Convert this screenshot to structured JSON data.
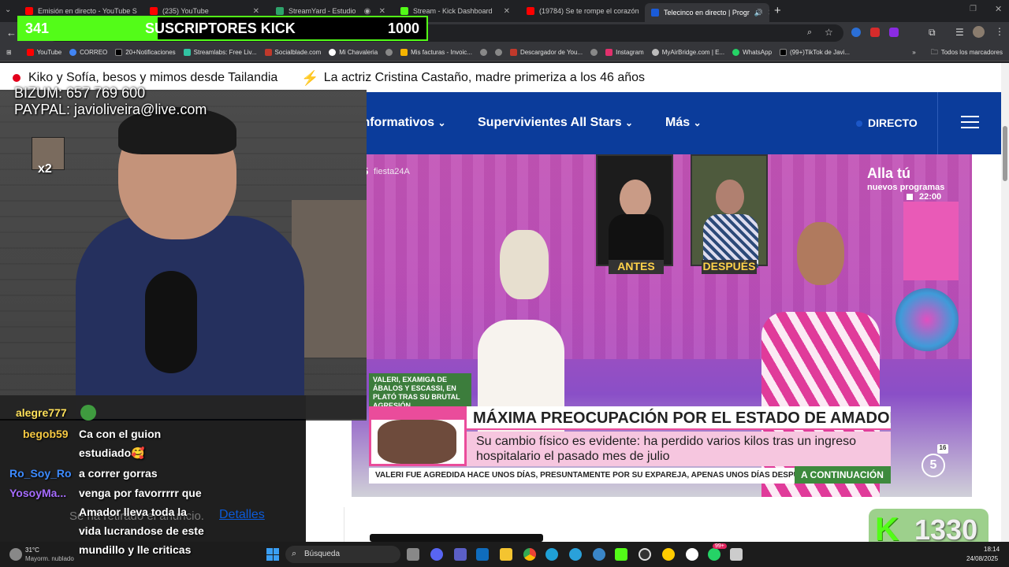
{
  "tabs": [
    {
      "label": "Emisión en directo - YouTube S",
      "fav": "#ff0000"
    },
    {
      "label": "(235) YouTube",
      "fav": "#ff0000"
    },
    {
      "label": "StreamYard - Estudio",
      "fav": "#2ea36b"
    },
    {
      "label": "Stream - Kick Dashboard",
      "fav": "#53fc18"
    },
    {
      "label": "(19784) Se te rompe el corazón",
      "fav": "#ff0000"
    },
    {
      "label": "Telecinco en directo | Progr",
      "fav": "#1a5bd8"
    }
  ],
  "new_tab": "+",
  "bookmarks": [
    {
      "label": "YouTube",
      "color": "#ff0000"
    },
    {
      "label": "CORREO",
      "color": "#4285f4"
    },
    {
      "label": "20+Notificaciones",
      "color": "#000000"
    },
    {
      "label": "Streamlabs: Free Liv...",
      "color": "#31c3a2"
    },
    {
      "label": "Socialblade.com",
      "color": "#c0392b"
    },
    {
      "label": "Mi Chavaleria",
      "color": "#888888"
    },
    {
      "label": "",
      "color": "#888888"
    },
    {
      "label": "Mis facturas - Invoic...",
      "color": "#f5b400"
    },
    {
      "label": "",
      "color": "#888888"
    },
    {
      "label": "",
      "color": "#888888"
    },
    {
      "label": "Descargador de You...",
      "color": "#c0392b"
    },
    {
      "label": "",
      "color": "#888888"
    },
    {
      "label": "Instagram",
      "color": "#e1306c"
    },
    {
      "label": "MyAirBridge.com | E...",
      "color": "#888888"
    },
    {
      "label": "WhatsApp",
      "color": "#25d366"
    },
    {
      "label": "(99+)TikTok de Javi...",
      "color": "#000000"
    }
  ],
  "bookmarks_more": "»",
  "all_bookmarks": "Todos los marcadores",
  "ticker": {
    "item1": "Kiko y Sofía, besos y mimos desde Tailandia",
    "item2": "La actriz Cristina Castaño, madre primeriza a los 46 años"
  },
  "nav": {
    "item1": "Informativos",
    "item2": "Supervivientes All Stars",
    "item3": "Más",
    "live": "DIRECTO"
  },
  "video": {
    "channel_tag": "fiesta24A",
    "promo_title": "Alla tú",
    "promo_sub": "nuevos programas",
    "promo_time": "22:00",
    "before": "ANTES",
    "after": "DESPUÉS",
    "side_caption": "VALERI, EXAMIGA DE ÁBALOS Y ESCASSI, EN PLATÓ TRAS SU BRUTAL AGRESIÓN",
    "headline": "MÁXIMA PREOCUPACIÓN POR EL ESTADO DE AMADOR MOHEDANO",
    "subline1": "Su cambio físico es evidente: ha perdido varios kilos tras un ingreso",
    "subline2": "hospitalario el pasado mes de julio",
    "crawl": "VALERI FUE AGREDIDA HACE UNOS DÍAS, PRESUNTAMENTE POR SU EXPAREJA, APENAS UNOS DÍAS DESPUÉS D",
    "next": "A CONTINUACIÓN",
    "rating": "16",
    "logo": "5"
  },
  "ad_notice": {
    "text": "Se ha retirado el anuncio.",
    "link": "Detalles"
  },
  "stream_overlay": {
    "bizum": "BIZUM: 657 769 600",
    "paypal": "PAYPAL: javioliveira@live.com",
    "multiplier": "x2",
    "subs_current": "341",
    "subs_label": "SUSCRIPTORES KICK",
    "subs_goal": "1000",
    "subs_progress": 0.341,
    "kick_count": "1330",
    "kick_logo": "K"
  },
  "chat": [
    {
      "user": "alegre777",
      "color": "#ffe15a",
      "message": ""
    },
    {
      "user": "begob59",
      "color": "#f5c842",
      "message": "Ca con el guion"
    },
    {
      "user": "",
      "color": "#ffffff",
      "message": "estudiado🥰"
    },
    {
      "user": "Ro_Soy_Ro",
      "color": "#3d8bff",
      "message": "a correr gorras"
    },
    {
      "user": "YosoyMa...",
      "color": "#a66cff",
      "message": "venga por favorrrrr que"
    },
    {
      "user": "",
      "color": "#ffffff",
      "message": "Amador lleva toda la"
    },
    {
      "user": "",
      "color": "#ffffff",
      "message": "vida lucrandose de este"
    },
    {
      "user": "",
      "color": "#ffffff",
      "message": "mundillo y lle criticas"
    }
  ],
  "taskbar": {
    "weather_temp": "31°C",
    "weather_desc": "Mayorm. nublado",
    "search": "Búsqueda",
    "time": "18:14",
    "date": "24/08/2025",
    "badge": "99+"
  }
}
